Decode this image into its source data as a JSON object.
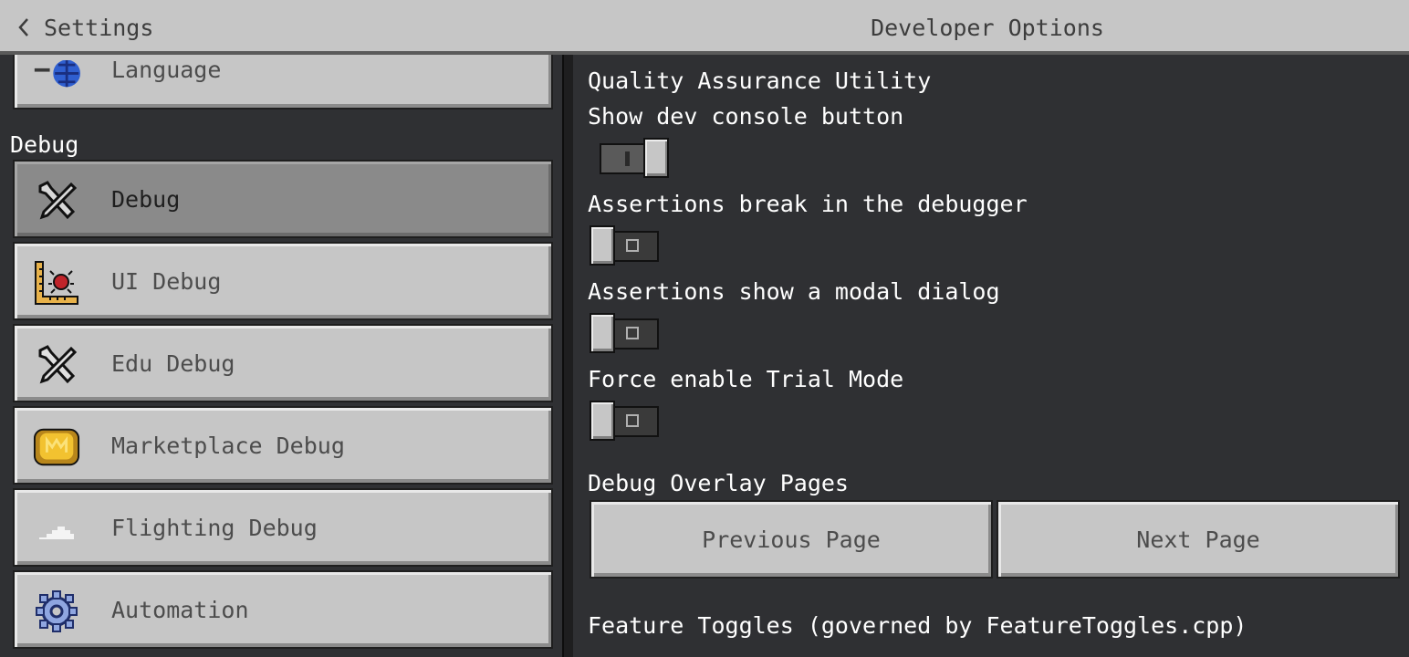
{
  "header": {
    "back_label": "Settings",
    "title": "Developer Options"
  },
  "sidebar": {
    "partial_item": {
      "label": "Language",
      "icon": "globe-icon"
    },
    "section_label": "Debug",
    "items": [
      {
        "label": "Debug",
        "icon": "wrench-screwdriver-icon",
        "selected": true
      },
      {
        "label": "UI Debug",
        "icon": "bug-ruler-icon",
        "selected": false
      },
      {
        "label": "Edu Debug",
        "icon": "wrench-screwdriver-icon",
        "selected": false
      },
      {
        "label": "Marketplace Debug",
        "icon": "minecoin-icon",
        "selected": false
      },
      {
        "label": "Flighting Debug",
        "icon": "cloud-icon",
        "selected": false
      },
      {
        "label": "Automation",
        "icon": "gear-icon",
        "selected": false
      }
    ]
  },
  "content": {
    "qa_heading": "Quality Assurance Utility",
    "toggles": [
      {
        "label": "Show dev console button",
        "on": true
      },
      {
        "label": "Assertions break in the debugger",
        "on": false
      },
      {
        "label": "Assertions show a modal dialog",
        "on": false
      },
      {
        "label": "Force enable Trial Mode",
        "on": false
      }
    ],
    "overlay_heading": "Debug Overlay Pages",
    "previous_page_label": "Previous Page",
    "next_page_label": "Next Page",
    "feature_toggles_heading": "Feature Toggles (governed by FeatureToggles.cpp)"
  },
  "colors": {
    "background": "#2f3033",
    "button_face": "#c6c6c6",
    "button_selected": "#8a8a8a",
    "header_bar": "#c6c6c6",
    "text_light": "#ffffff",
    "text_dark": "#4c4c4c"
  }
}
